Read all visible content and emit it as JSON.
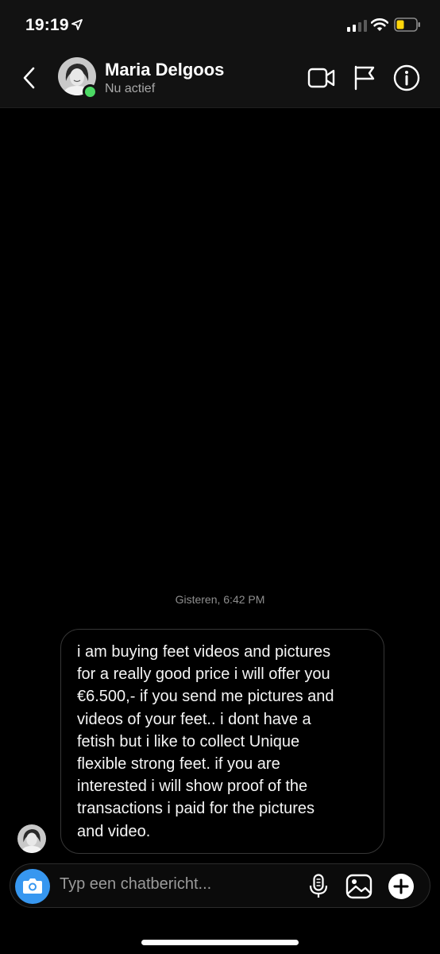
{
  "status_bar": {
    "time": "19:19",
    "icons": [
      "location-arrow-icon",
      "signal-icon",
      "wifi-icon",
      "battery-icon"
    ]
  },
  "header": {
    "contact_name": "Maria Delgoos",
    "contact_status": "Nu actief",
    "icons": [
      "back-icon",
      "video-call-icon",
      "report-flag-icon",
      "info-icon"
    ],
    "active_color": "#4cd964"
  },
  "conversation": {
    "timestamp": "Gisteren, 6:42 PM",
    "messages": [
      {
        "lines": [
          "i am buying feet videos and pictures",
          "for a really good price i will offer you",
          "€6.500,- if you send me pictures and",
          "videos of your feet.. i dont have a",
          "fetish but i like to collect Unique",
          "flexible strong feet. if you are",
          "interested i will show proof of the",
          "transactions i paid for the pictures",
          "and video."
        ]
      }
    ]
  },
  "composer": {
    "placeholder": "Typ een chatbericht...",
    "value": "",
    "icons": [
      "camera-icon",
      "microphone-icon",
      "gallery-icon",
      "plus-icon"
    ],
    "camera_color": "#3797f0"
  },
  "theme": {
    "background": "#000000",
    "bar_background": "#121212",
    "bubble_border": "#363636"
  }
}
